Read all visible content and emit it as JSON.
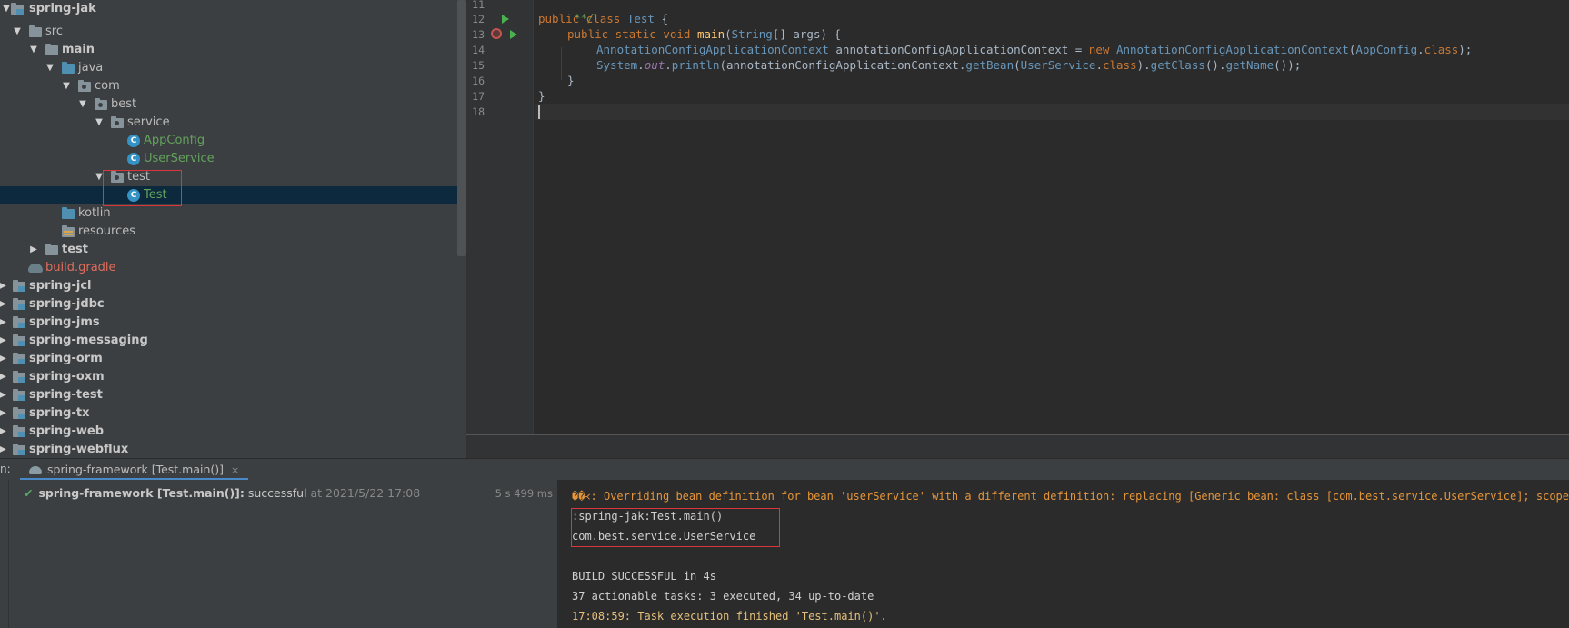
{
  "tree": {
    "items": [
      {
        "label": "spring-jak",
        "type": "module",
        "bold": true,
        "expanded": true
      },
      {
        "label": "src",
        "type": "folder",
        "expanded": true
      },
      {
        "label": "main",
        "type": "folder",
        "bold": true,
        "expanded": true
      },
      {
        "label": "java",
        "type": "source-folder",
        "expanded": true
      },
      {
        "label": "com",
        "type": "package",
        "expanded": true
      },
      {
        "label": "best",
        "type": "package",
        "expanded": true
      },
      {
        "label": "service",
        "type": "package",
        "expanded": true
      },
      {
        "label": "AppConfig",
        "type": "class"
      },
      {
        "label": "UserService",
        "type": "class"
      },
      {
        "label": "test",
        "type": "package",
        "expanded": true
      },
      {
        "label": "Test",
        "type": "class",
        "selected": true
      },
      {
        "label": "kotlin",
        "type": "source-folder"
      },
      {
        "label": "resources",
        "type": "resources-folder"
      },
      {
        "label": "test",
        "type": "folder",
        "bold": true,
        "expanded": false
      },
      {
        "label": "build.gradle",
        "type": "gradle-file"
      },
      {
        "label": "spring-jcl",
        "type": "module"
      },
      {
        "label": "spring-jdbc",
        "type": "module"
      },
      {
        "label": "spring-jms",
        "type": "module"
      },
      {
        "label": "spring-messaging",
        "type": "module"
      },
      {
        "label": "spring-orm",
        "type": "module"
      },
      {
        "label": "spring-oxm",
        "type": "module"
      },
      {
        "label": "spring-test",
        "type": "module"
      },
      {
        "label": "spring-tx",
        "type": "module"
      },
      {
        "label": "spring-web",
        "type": "module"
      },
      {
        "label": "spring-webflux",
        "type": "module"
      }
    ]
  },
  "editor": {
    "line_numbers": [
      "11",
      "12",
      "13",
      "14",
      "15",
      "16",
      "17",
      "18"
    ],
    "lines": {
      "l11": "**/",
      "l12_kw": "public class ",
      "l12_name": "Test ",
      "l12_rest": "{",
      "l13_kw": "public static void ",
      "l13_fn": "main",
      "l13_p1": "(",
      "l13_type": "String",
      "l13_p2": "[] args) {",
      "l14_type1": "AnnotationConfigApplicationContext",
      "l14_var": " annotationConfigApplicationContext = ",
      "l14_new": "new ",
      "l14_type2": "AnnotationConfigApplicationContext",
      "l14_p1": "(",
      "l14_type3": "AppConfig",
      "l14_p2": ".",
      "l14_kwclass": "class",
      "l14_end": ");",
      "l15_type": "System",
      "l15_dot": ".",
      "l15_out": "out",
      "l15_m1": ".",
      "l15_fn1": "println",
      "l15_mid": "(annotationConfigApplicationContext.",
      "l15_fn2": "getBean",
      "l15_p1": "(",
      "l15_type2": "UserService",
      "l15_p2": ".",
      "l15_kwclass": "class",
      "l15_p3": ").",
      "l15_fn3": "getClass",
      "l15_p4": "().",
      "l15_fn4": "getName",
      "l15_end": "());",
      "l16": "}",
      "l17": "}"
    }
  },
  "run_panel": {
    "prefix": "n:",
    "tab_label": "spring-framework [Test.main()]",
    "tab_close": "×",
    "run_name": "spring-framework [Test.main()]:",
    "run_status": " successful",
    "run_time": " at 2021/5/22 17:08",
    "run_duration": "5 s 499 ms",
    "console_lines": [
      {
        "text": "��᚜: Overriding bean definition for bean 'userService' with a different definition: replacing [Generic bean: class [com.best.service.UserService]; scope=si",
        "style": "warn"
      },
      {
        "text": ":spring-jak:Test.main()",
        "style": "plain"
      },
      {
        "text": "com.best.service.UserService",
        "style": "plain"
      },
      {
        "text": "",
        "style": "plain"
      },
      {
        "text": "BUILD SUCCESSFUL in 4s",
        "style": "plain"
      },
      {
        "text": "37 actionable tasks: 3 executed, 34 up-to-date",
        "style": "plain"
      },
      {
        "text": "17:08:59: Task execution finished 'Test.main()'.",
        "style": "ts"
      }
    ]
  }
}
